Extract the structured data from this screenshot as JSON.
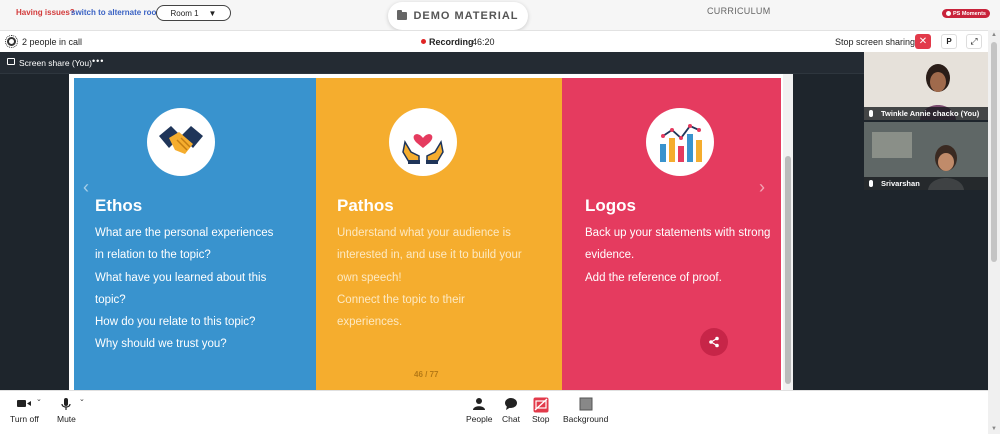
{
  "topbar": {
    "issues_text": "Having issues?",
    "alt_room_link": "switch to alternate room",
    "room_select_value": "Room 1",
    "demo_tab_label": "DEMO MATERIAL",
    "curriculum_label": "CURRICULUM",
    "ps_badge": "PS Moments"
  },
  "callbar": {
    "people_count": "2 people in call",
    "recording_label": "Recording",
    "recording_time": "46:20",
    "stop_share_label": "Stop screen sharing",
    "close_label": "✕",
    "p_label": "P",
    "expand_label": "⤢"
  },
  "screen_share": {
    "label": "Screen share (You)",
    "more": "•••"
  },
  "slide": {
    "page": "46 / 77",
    "nav_prev": "‹",
    "nav_next": "›",
    "panels": [
      {
        "title": "Ethos",
        "icon": "handshake-icon",
        "color": "#3993ce",
        "lines": [
          "What are the personal experiences",
          "in relation to the topic?",
          "What have you learned about this",
          "topic?",
          "How do you relate to this topic?",
          "Why should we trust you?"
        ]
      },
      {
        "title": "Pathos",
        "icon": "heart-hands-icon",
        "color": "#f5ad2e",
        "lines": [
          "Understand what your audience is",
          "interested in, and use it to build your",
          "own speech!",
          "Connect the topic to their",
          "experiences."
        ]
      },
      {
        "title": "Logos",
        "icon": "bar-chart-icon",
        "color": "#e53b5f",
        "lines": [
          "Back up your statements with strong",
          "evidence.",
          "Add the reference of proof."
        ]
      }
    ]
  },
  "participants": [
    {
      "name": "Twinkle Annie chacko (You)"
    },
    {
      "name": "Srivarshan"
    }
  ],
  "toolbar": {
    "turn_off": "Turn off",
    "mute": "Mute",
    "people": "People",
    "chat": "Chat",
    "stop": "Stop",
    "background": "Background",
    "caret": "⌄"
  }
}
